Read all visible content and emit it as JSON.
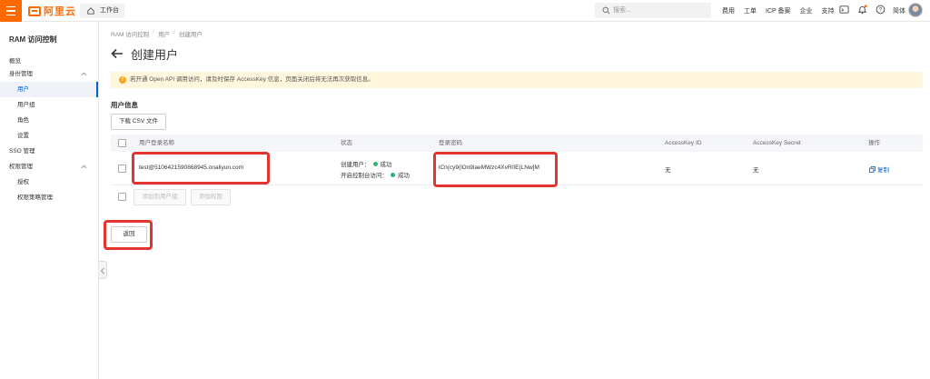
{
  "topbar": {
    "logo_text": "阿里云",
    "workbench_label": "工作台",
    "search_placeholder": "搜索...",
    "nav_links": [
      "费用",
      "工单",
      "ICP 备案",
      "企业",
      "支持"
    ],
    "user_name": "简体",
    "accent_color": "#ff6a00"
  },
  "sidebar": {
    "title": "RAM 访问控制",
    "items": [
      {
        "label": "概览"
      },
      {
        "label": "身份管理"
      },
      {
        "label": "用户"
      },
      {
        "label": "用户组"
      },
      {
        "label": "角色"
      },
      {
        "label": "设置"
      },
      {
        "label": "SSO 管理"
      },
      {
        "label": "权限管理"
      },
      {
        "label": "授权"
      },
      {
        "label": "权限策略管理"
      }
    ]
  },
  "breadcrumb": [
    "RAM 访问控制",
    "用户",
    "创建用户"
  ],
  "page_title": "创建用户",
  "notice": "若开通 Open API 调用访问，请及时保存 AccessKey 信息，页面关闭后将无法再次获取信息。",
  "section_title": "用户信息",
  "download_csv_label": "下载 CSV 文件",
  "table": {
    "headers": [
      "用户登录名称",
      "状态",
      "登录密码",
      "AccessKey ID",
      "AccessKey Secret",
      "操作"
    ],
    "row": {
      "login_name": "test@5106421590868945.onaliyun.com",
      "status_create_label": "创建用户：",
      "status_create_value": "成功",
      "status_console_label": "开启控制台访问：",
      "status_console_value": "成功",
      "password": "lCn(cy9(lOn9laeMWzc4XvR0E(LNw]M",
      "access_key_id": "无",
      "access_key_secret": "无",
      "action": "复制"
    }
  },
  "add_to_group_label": "添加到用户组",
  "add_permission_label": "添加权限",
  "return_label": "返回",
  "colors": {
    "link": "#0064c8",
    "success": "#2bb673",
    "highlight": "#e3342f",
    "warning_bg": "#fff6dd"
  }
}
